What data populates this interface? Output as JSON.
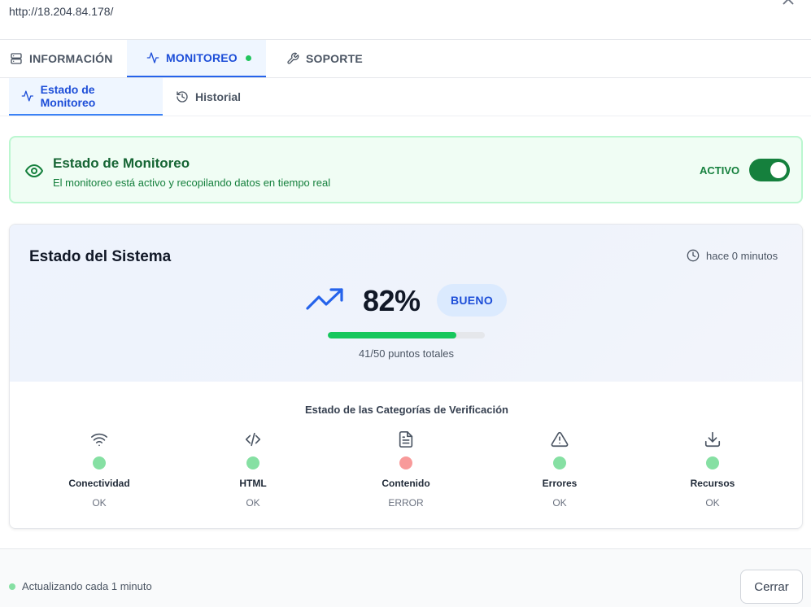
{
  "header": {
    "url": "http://18.204.84.178/",
    "close_icon": "close-icon"
  },
  "main_tabs": [
    {
      "label": "INFORMACIÓN",
      "icon": "server-icon",
      "active": false
    },
    {
      "label": "MONITOREO",
      "icon": "activity-icon",
      "active": true,
      "live_indicator_color": "#22c55e"
    },
    {
      "label": "SOPORTE",
      "icon": "wrench-icon",
      "active": false
    }
  ],
  "sub_tabs": [
    {
      "label": "Estado de Monitoreo",
      "icon": "activity-icon",
      "active": true
    },
    {
      "label": "Historial",
      "icon": "history-icon",
      "active": false
    }
  ],
  "monitor_status": {
    "title": "Estado de Monitoreo",
    "description": "El monitoreo está activo y recopilando datos en tiempo real",
    "state_label": "ACTIVO",
    "enabled": true,
    "color": "#15803d"
  },
  "system_status": {
    "title": "Estado del Sistema",
    "updated": "hace 0 minutos",
    "percentage": "82%",
    "rating": "BUENO",
    "progress": 0.82,
    "points": "41/50 puntos totales",
    "categories_title": "Estado de las Categorías de Verificación",
    "categories": [
      {
        "name": "Conectividad",
        "status": "OK",
        "ok": true,
        "icon": "wifi-icon"
      },
      {
        "name": "HTML",
        "status": "OK",
        "ok": true,
        "icon": "code-icon"
      },
      {
        "name": "Contenido",
        "status": "ERROR",
        "ok": false,
        "icon": "document-icon"
      },
      {
        "name": "Errores",
        "status": "OK",
        "ok": true,
        "icon": "warning-icon"
      },
      {
        "name": "Recursos",
        "status": "OK",
        "ok": true,
        "icon": "download-icon"
      }
    ]
  },
  "footer": {
    "update_text": "Actualizando cada 1 minuto",
    "close_label": "Cerrar"
  }
}
